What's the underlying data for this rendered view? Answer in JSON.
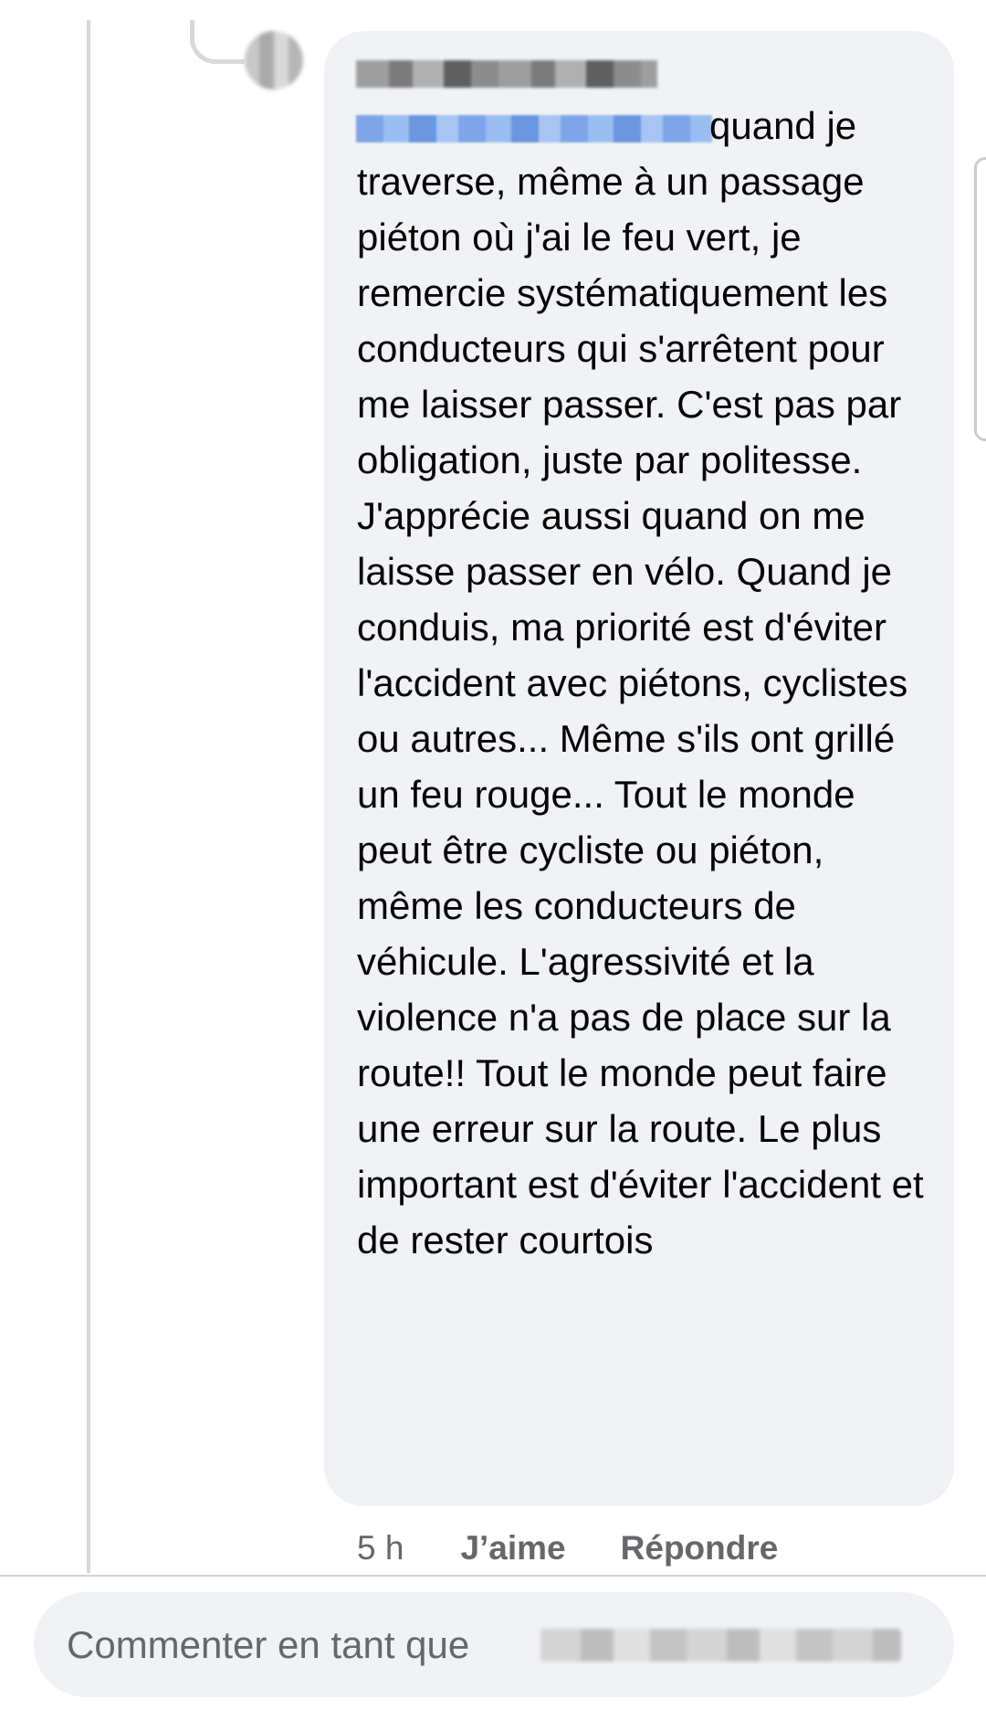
{
  "comment": {
    "text": "quand je traverse, même à un passage piéton où j'ai le feu vert, je remercie systématiquement les conducteurs qui s'arrêtent pour me laisser passer. C'est pas par obligation, juste par politesse. J'apprécie aussi quand on me laisse passer en vélo. Quand je conduis, ma priorité est d'éviter l'accident avec piétons, cyclistes ou autres... Même s'ils ont grillé un feu rouge... Tout le monde peut être cycliste ou piéton, même les conducteurs de véhicule. L'agressivité et la violence n'a pas de place sur la route!! Tout le monde peut faire une erreur sur la route. Le plus important est d'éviter l'accident et de rester courtois",
    "time": "5 h",
    "like_label": "J’aime",
    "reply_label": "Répondre"
  },
  "composer": {
    "placeholder": "Commenter en tant que"
  },
  "colors": {
    "bubble_bg": "#f0f2f5",
    "secondary_text": "#65676b",
    "mention_blue": "#7fa5e8"
  }
}
